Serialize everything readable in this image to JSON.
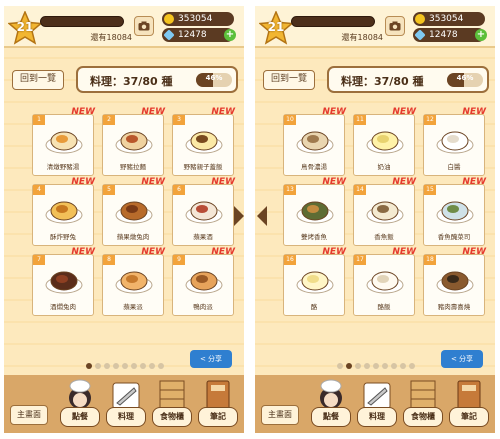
{
  "hud": {
    "level": "21",
    "xp_remaining": "還有18084",
    "coins": "353054",
    "gems": "12478",
    "gem_plus": "+"
  },
  "nav": {
    "back_label": "回到一覽",
    "main_label": "主畫面",
    "share_label": "分享",
    "tabs": [
      "點餐",
      "料理",
      "食物櫃",
      "筆記"
    ]
  },
  "recipes": {
    "count_text": "料理：37/80 種",
    "percent_text": "46%",
    "percent_value": 0.46
  },
  "new_badge": "NEW",
  "pages": [
    {
      "dots_active": 0,
      "items": [
        {
          "num": "1",
          "name": "清燉野豬湯"
        },
        {
          "num": "2",
          "name": "野豬拉麵"
        },
        {
          "num": "3",
          "name": "野豬親子蓋飯"
        },
        {
          "num": "4",
          "name": "酥炸野兔"
        },
        {
          "num": "5",
          "name": "蘋果燉兔肉"
        },
        {
          "num": "6",
          "name": "蘋果酒"
        },
        {
          "num": "7",
          "name": "酒燜兔肉"
        },
        {
          "num": "8",
          "name": "蘋果派"
        },
        {
          "num": "9",
          "name": "鴨肉派"
        }
      ]
    },
    {
      "dots_active": 1,
      "items": [
        {
          "num": "10",
          "name": "鳥骨濃湯"
        },
        {
          "num": "11",
          "name": "奶油"
        },
        {
          "num": "12",
          "name": "白醬"
        },
        {
          "num": "13",
          "name": "雙烤香魚"
        },
        {
          "num": "14",
          "name": "香魚飯"
        },
        {
          "num": "15",
          "name": "香魚醃菜司"
        },
        {
          "num": "16",
          "name": "酪"
        },
        {
          "num": "17",
          "name": "酪飯"
        },
        {
          "num": "18",
          "name": "豬肉壽喜燒"
        }
      ]
    }
  ],
  "colors": {
    "accent": "#f2a33b",
    "new": "#e53a2e",
    "share": "#2f7fd0",
    "panel": "#fde7b8"
  }
}
